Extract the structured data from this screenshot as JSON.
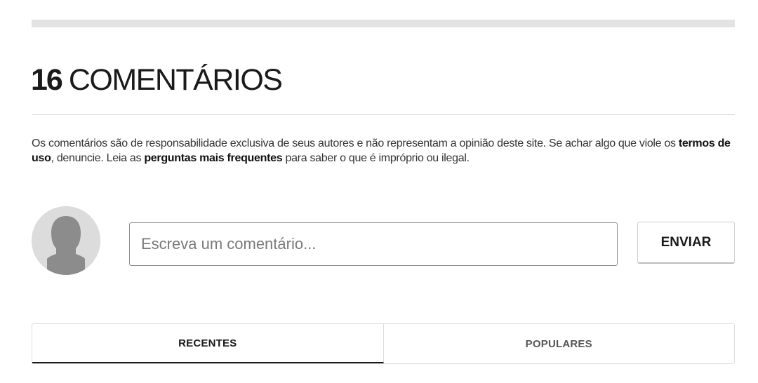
{
  "comments": {
    "count": "16",
    "title": "COMENTÁRIOS"
  },
  "disclaimer": {
    "part1": "Os comentários são de responsabilidade exclusiva de seus autores e não representam a opinião deste site. Se achar algo que viole os ",
    "terms_link": "termos de uso",
    "part2": ", denuncie. Leia as ",
    "faq_link": "perguntas mais frequentes",
    "part3": " para saber o que é impróprio ou ilegal."
  },
  "composer": {
    "avatar_icon": "user-silhouette-icon",
    "placeholder": "Escreva um comentário...",
    "send_label": "ENVIAR"
  },
  "tabs": [
    {
      "label": "RECENTES",
      "active": true
    },
    {
      "label": "POPULARES",
      "active": false
    }
  ],
  "colors": {
    "text": "#1a1a1a",
    "border": "#dcdcdc",
    "avatar_bg": "#dcdcdc",
    "avatar_fg": "#8c8c8c"
  }
}
